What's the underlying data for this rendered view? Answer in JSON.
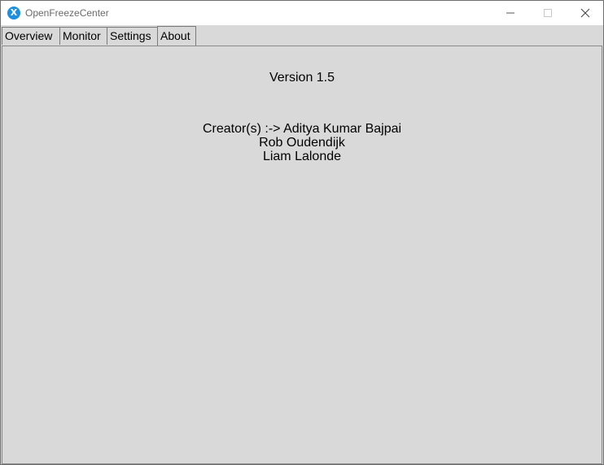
{
  "window": {
    "title": "OpenFreezeCenter",
    "icon_glyph": "X",
    "icon_name": "app-icon",
    "accent_color": "#1b8fe0"
  },
  "controls": {
    "minimize_icon": "minimize-icon",
    "maximize_icon": "maximize-icon",
    "close_icon": "close-icon"
  },
  "tabs": [
    {
      "label": "Overview"
    },
    {
      "label": "Monitor"
    },
    {
      "label": "Settings"
    },
    {
      "label": "About",
      "selected": true
    }
  ],
  "about": {
    "version": "Version 1.5",
    "creators_line1": "Creator(s) :-> Aditya Kumar Bajpai",
    "creators_line2": "Rob Oudendijk",
    "creators_line3": "Liam Lalonde"
  }
}
